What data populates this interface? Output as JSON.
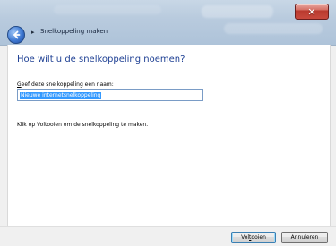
{
  "window": {
    "close_glyph": "✕"
  },
  "header": {
    "breadcrumb_separator": "▸",
    "title": "Snelkoppeling maken"
  },
  "main": {
    "heading": "Hoe wilt u de snelkoppeling noemen?",
    "name_field": {
      "label_accesskey": "G",
      "label_rest": "eef deze snelkoppeling een naam:",
      "value": "Nieuwe internetsnelkoppeling"
    },
    "instruction": "Klik op Voltooien om de snelkoppeling te maken."
  },
  "footer": {
    "finish_before": "Vol",
    "finish_accesskey": "t",
    "finish_after": "ooien",
    "cancel_label": "Annuleren"
  },
  "colors": {
    "heading_blue": "#1d3f93",
    "selection_blue": "#3399ff",
    "close_red": "#c8493d"
  },
  "icons": {
    "back": "back-arrow-icon",
    "close": "close-icon"
  }
}
